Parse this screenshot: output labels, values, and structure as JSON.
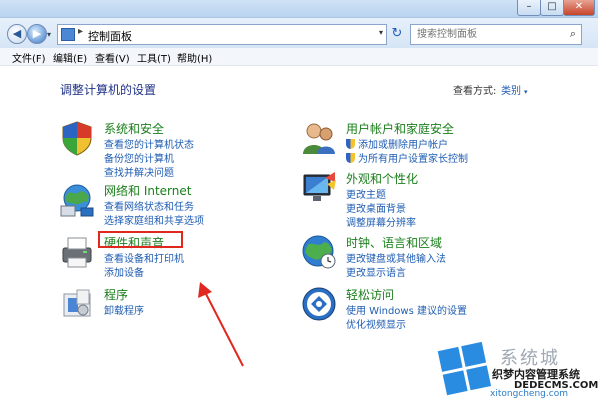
{
  "window": {
    "controls": {
      "minimize": "–",
      "maximize": "□",
      "close": "✕"
    }
  },
  "address": {
    "back_glyph": "◀",
    "forward_glyph": "▶",
    "history_glyph": "▾",
    "path_separator": "▸",
    "path": "控制面板",
    "path_dropdown": "▾",
    "refresh_glyph": "↻",
    "search_placeholder": "搜索控制面板",
    "search_icon": "search-icon"
  },
  "menubar": [
    "文件(F)",
    "编辑(E)",
    "查看(V)",
    "工具(T)",
    "帮助(H)"
  ],
  "content": {
    "heading": "调整计算机的设置",
    "view_label": "查看方式:",
    "view_value": "类别",
    "view_dropdown": "▾",
    "left_categories": [
      {
        "icon": "security-shield-icon",
        "title": "系统和安全",
        "links": [
          "查看您的计算机状态",
          "备份您的计算机",
          "查找并解决问题"
        ]
      },
      {
        "icon": "network-globe-icon",
        "title": "网络和 Internet",
        "links": [
          "查看网络状态和任务",
          "选择家庭组和共享选项"
        ]
      },
      {
        "icon": "printer-icon",
        "title": "硬件和声音",
        "links": [
          "查看设备和打印机",
          "添加设备"
        ]
      },
      {
        "icon": "programs-icon",
        "title": "程序",
        "links": [
          "卸载程序"
        ]
      }
    ],
    "right_categories": [
      {
        "icon": "users-icon",
        "title": "用户帐户和家庭安全",
        "links": [
          "添加或删除用户帐户",
          "为所有用户设置家长控制"
        ]
      },
      {
        "icon": "monitor-icon",
        "title": "外观和个性化",
        "links": [
          "更改主题",
          "更改桌面背景",
          "调整屏幕分辨率"
        ]
      },
      {
        "icon": "clock-globe-icon",
        "title": "时钟、语言和区域",
        "links": [
          "更改键盘或其他输入法",
          "更改显示语言"
        ]
      },
      {
        "icon": "ease-of-access-icon",
        "title": "轻松访问",
        "links": [
          "使用 Windows 建议的设置",
          "优化视频显示"
        ]
      }
    ]
  },
  "colors": {
    "title_green": "#1a7f1a",
    "link_blue": "#1e5db3",
    "highlight_red": "#e0281f"
  },
  "watermark": {
    "brand": "系统城",
    "site": "织梦内容管理系统",
    "domain": "DEDECMS.COM",
    "url": "xitongcheng.com"
  }
}
